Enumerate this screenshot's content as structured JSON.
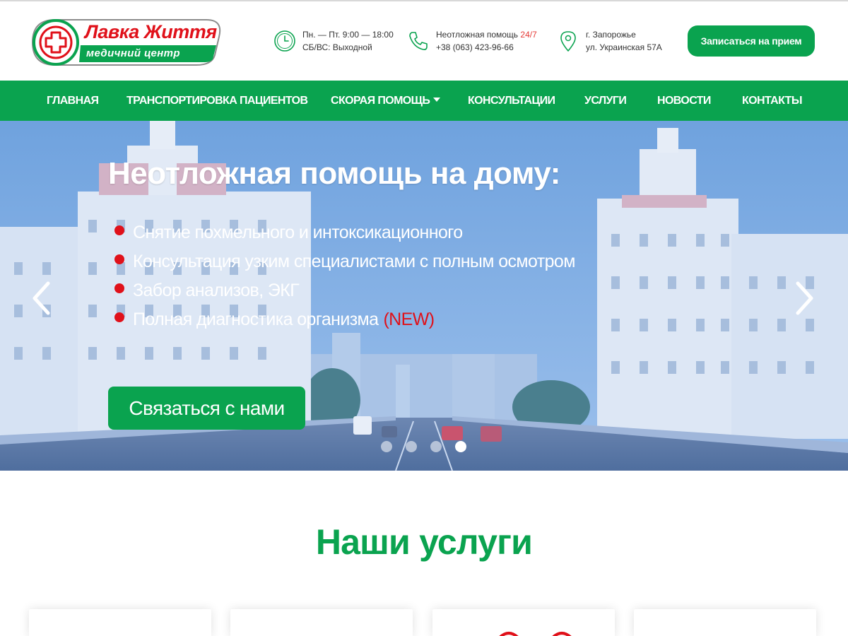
{
  "logo": {
    "title": "Лавка Життя",
    "subtitle": "медичний центр"
  },
  "header": {
    "hours": {
      "line1": "Пн. — Пт. 9:00 — 18:00",
      "line2": "СБ/ВС: Выходной"
    },
    "emergency": {
      "label": "Неотложная помощь",
      "badge": "24/7",
      "phone": "+38 (063) 423-96-66"
    },
    "address": {
      "city": "г. Запорожье",
      "street": "ул. Украинская 57А"
    },
    "cta_label": "Записаться на прием"
  },
  "nav": {
    "items": [
      {
        "label": "ГЛАВНАЯ"
      },
      {
        "label": "ТРАНСПОРТИРОВКА ПАЦИЕНТОВ"
      },
      {
        "label": "СКОРАЯ ПОМОЩЬ"
      },
      {
        "label": "КОНСУЛЬТАЦИИ"
      },
      {
        "label": "УСЛУГИ"
      },
      {
        "label": "НОВОСТИ"
      },
      {
        "label": "КОНТАКТЫ"
      }
    ]
  },
  "hero": {
    "title": "Неотложная помощь на дому:",
    "items": [
      "Снятие похмельного и интоксикационного",
      "Консультация узким специалистами с полным осмотром",
      "Забор анализов, ЭКГ",
      "Полная диагностика организма"
    ],
    "new_tag": "(NEW)",
    "button_label": "Связаться с нами",
    "slide_count": 4,
    "active_slide": 4
  },
  "services": {
    "title": "Наши услуги"
  },
  "colors": {
    "brand_green": "#0aa34f",
    "accent_red": "#e0111a",
    "hero_overlay": "#4f86cf"
  },
  "icons": {
    "hours": "clock-icon",
    "emergency": "phone-icon",
    "address": "map-pin-icon",
    "prev": "chevron-left-icon",
    "next": "chevron-right-icon"
  }
}
